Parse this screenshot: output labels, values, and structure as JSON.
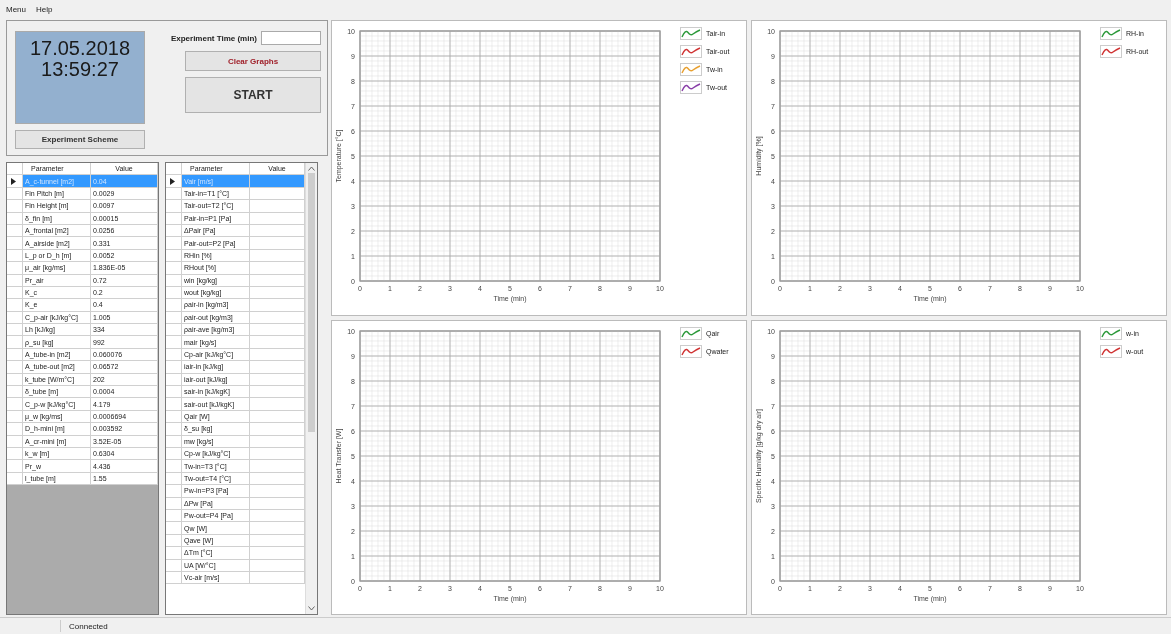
{
  "menu": [
    "Menu",
    "Help"
  ],
  "clock": {
    "date": "17.05.2018",
    "time": "13:59:27"
  },
  "experiment_time": {
    "label": "Experiment Time (min)"
  },
  "buttons": {
    "scheme": "Experiment Scheme",
    "clear": "Clear Graphs",
    "start": "START"
  },
  "tables": [
    {
      "has_scrollbar": false,
      "columns": [
        "Parameter",
        "Value"
      ],
      "rows": [
        {
          "parameter": "A_c-tunnel [m2]",
          "value": "0.04",
          "selected": true
        },
        {
          "parameter": "Fin Pitch [m]",
          "value": "0.0029",
          "selected": false
        },
        {
          "parameter": "Fin Height [m]",
          "value": "0.0097",
          "selected": false
        },
        {
          "parameter": "δ_fin [m]",
          "value": "0.00015",
          "selected": false
        },
        {
          "parameter": "A_frontal [m2]",
          "value": "0.0256",
          "selected": false
        },
        {
          "parameter": "A_airside [m2]",
          "value": "0.331",
          "selected": false
        },
        {
          "parameter": "L_p or D_h [m]",
          "value": "0.0052",
          "selected": false
        },
        {
          "parameter": "μ_air [kg/ms]",
          "value": "1.836E-05",
          "selected": false
        },
        {
          "parameter": "Pr_air",
          "value": "0.72",
          "selected": false
        },
        {
          "parameter": "K_c",
          "value": "0.2",
          "selected": false
        },
        {
          "parameter": "K_e",
          "value": "0.4",
          "selected": false
        },
        {
          "parameter": "C_p-air [kJ/kg°C]",
          "value": "1.005",
          "selected": false
        },
        {
          "parameter": "Lh [kJ/kg]",
          "value": "334",
          "selected": false
        },
        {
          "parameter": "ρ_su [kg]",
          "value": "992",
          "selected": false
        },
        {
          "parameter": "A_tube-in [m2]",
          "value": "0.060076",
          "selected": false
        },
        {
          "parameter": "A_tube-out [m2]",
          "value": "0.06572",
          "selected": false
        },
        {
          "parameter": "k_tube [W/m°C]",
          "value": "202",
          "selected": false
        },
        {
          "parameter": "δ_tube [m]",
          "value": "0.0004",
          "selected": false
        },
        {
          "parameter": "C_p-w [kJ/kg°C]",
          "value": "4.179",
          "selected": false
        },
        {
          "parameter": "μ_w [kg/ms]",
          "value": "0.0006694",
          "selected": false
        },
        {
          "parameter": "D_h-mini [m]",
          "value": "0.003592",
          "selected": false
        },
        {
          "parameter": "A_cr-mini [m]",
          "value": "3.52E-05",
          "selected": false
        },
        {
          "parameter": "k_w [m]",
          "value": "0.6304",
          "selected": false
        },
        {
          "parameter": "Pr_w",
          "value": "4.436",
          "selected": false
        },
        {
          "parameter": "l_tube [m]",
          "value": "1.55",
          "selected": false
        }
      ]
    },
    {
      "has_scrollbar": true,
      "columns": [
        "Parameter",
        "Value"
      ],
      "rows": [
        {
          "parameter": "Vair [m/s]",
          "selected": true
        },
        {
          "parameter": "Tair-in=T1 [°C]",
          "selected": false
        },
        {
          "parameter": "Tair-out=T2 [°C]",
          "selected": false
        },
        {
          "parameter": "Pair-in=P1 [Pa]",
          "selected": false
        },
        {
          "parameter": "ΔPair [Pa]",
          "selected": false
        },
        {
          "parameter": "Pair-out=P2 [Pa]",
          "selected": false
        },
        {
          "parameter": "RHin [%]",
          "selected": false
        },
        {
          "parameter": "RHout [%]",
          "selected": false
        },
        {
          "parameter": "win [kg/kg]",
          "selected": false
        },
        {
          "parameter": "wout [kg/kg]",
          "selected": false
        },
        {
          "parameter": "ρair-in [kg/m3]",
          "selected": false
        },
        {
          "parameter": "ρair-out [kg/m3]",
          "selected": false
        },
        {
          "parameter": "ρair-ave [kg/m3]",
          "selected": false
        },
        {
          "parameter": "mair [kg/s]",
          "selected": false
        },
        {
          "parameter": "Cp-air [kJ/kg°C]",
          "selected": false
        },
        {
          "parameter": "iair-in [kJ/kg]",
          "selected": false
        },
        {
          "parameter": "iair-out [kJ/kg]",
          "selected": false
        },
        {
          "parameter": "sair-in [kJ/kgK]",
          "selected": false
        },
        {
          "parameter": "sair-out [kJ/kgK]",
          "selected": false
        },
        {
          "parameter": "Qair [W]",
          "selected": false
        },
        {
          "parameter": "δ_su [kg]",
          "selected": false
        },
        {
          "parameter": "mw [kg/s]",
          "selected": false
        },
        {
          "parameter": "Cp-w [kJ/kg°C]",
          "selected": false
        },
        {
          "parameter": "Tw-in=T3 [°C]",
          "selected": false
        },
        {
          "parameter": "Tw-out=T4 [°C]",
          "selected": false
        },
        {
          "parameter": "Pw-in=P3 [Pa]",
          "selected": false
        },
        {
          "parameter": "ΔPw [Pa]",
          "selected": false
        },
        {
          "parameter": "Pw-out=P4 [Pa]",
          "selected": false
        },
        {
          "parameter": "Qw [W]",
          "selected": false
        },
        {
          "parameter": "Qave [W]",
          "selected": false
        },
        {
          "parameter": "ΔTm [°C]",
          "selected": false
        },
        {
          "parameter": "UA [W/°C]",
          "selected": false
        },
        {
          "parameter": "Vc-air [m/s]",
          "selected": false
        }
      ]
    }
  ],
  "charts": [
    {
      "chart_data": {
        "type": "line",
        "grid": true,
        "xlabel": "Time (min)",
        "ylabel": "Temperature [°C]",
        "categories": [
          "0",
          "1",
          "2",
          "3",
          "4",
          "5",
          "6",
          "7",
          "8",
          "9",
          "10"
        ],
        "ylim": [
          0,
          10
        ],
        "yticks": [
          0,
          1,
          2,
          3,
          4,
          5,
          6,
          7,
          8,
          9,
          10
        ],
        "series": [
          {
            "name": "Tair-in",
            "color": "#2e9a3c",
            "values": [
              null,
              null,
              null,
              null,
              null,
              null,
              null,
              null,
              null,
              null,
              null
            ]
          },
          {
            "name": "Tair-out",
            "color": "#d03434",
            "values": [
              null,
              null,
              null,
              null,
              null,
              null,
              null,
              null,
              null,
              null,
              null
            ]
          },
          {
            "name": "Tw-in",
            "color": "#e8a030",
            "values": [
              null,
              null,
              null,
              null,
              null,
              null,
              null,
              null,
              null,
              null,
              null
            ]
          },
          {
            "name": "Tw-out",
            "color": "#8a3fa8",
            "values": [
              null,
              null,
              null,
              null,
              null,
              null,
              null,
              null,
              null,
              null,
              null
            ]
          }
        ]
      }
    },
    {
      "chart_data": {
        "type": "line",
        "grid": true,
        "xlabel": "Time (min)",
        "ylabel": "Humidity [%]",
        "categories": [
          "0",
          "1",
          "2",
          "3",
          "4",
          "5",
          "6",
          "7",
          "8",
          "9",
          "10"
        ],
        "ylim": [
          0,
          10
        ],
        "yticks": [
          0,
          1,
          2,
          3,
          4,
          5,
          6,
          7,
          8,
          9,
          10
        ],
        "series": [
          {
            "name": "RH-in",
            "color": "#2e9a3c",
            "values": [
              null,
              null,
              null,
              null,
              null,
              null,
              null,
              null,
              null,
              null,
              null
            ]
          },
          {
            "name": "RH-out",
            "color": "#d03434",
            "values": [
              null,
              null,
              null,
              null,
              null,
              null,
              null,
              null,
              null,
              null,
              null
            ]
          }
        ]
      }
    },
    {
      "chart_data": {
        "type": "line",
        "grid": true,
        "xlabel": "Time (min)",
        "ylabel": "Heat Transfer [W]",
        "categories": [
          "0",
          "1",
          "2",
          "3",
          "4",
          "5",
          "6",
          "7",
          "8",
          "9",
          "10"
        ],
        "ylim": [
          0,
          10
        ],
        "yticks": [
          0,
          1,
          2,
          3,
          4,
          5,
          6,
          7,
          8,
          9,
          10
        ],
        "series": [
          {
            "name": "Qair",
            "color": "#2e9a3c",
            "values": [
              null,
              null,
              null,
              null,
              null,
              null,
              null,
              null,
              null,
              null,
              null
            ]
          },
          {
            "name": "Qwater",
            "color": "#d03434",
            "values": [
              null,
              null,
              null,
              null,
              null,
              null,
              null,
              null,
              null,
              null,
              null
            ]
          }
        ]
      }
    },
    {
      "chart_data": {
        "type": "line",
        "grid": true,
        "xlabel": "Time (min)",
        "ylabel": "Specific Humidity [g/kg dry air]",
        "categories": [
          "0",
          "1",
          "2",
          "3",
          "4",
          "5",
          "6",
          "7",
          "8",
          "9",
          "10"
        ],
        "ylim": [
          0,
          10
        ],
        "yticks": [
          0,
          1,
          2,
          3,
          4,
          5,
          6,
          7,
          8,
          9,
          10
        ],
        "series": [
          {
            "name": "w-in",
            "color": "#2e9a3c",
            "values": [
              null,
              null,
              null,
              null,
              null,
              null,
              null,
              null,
              null,
              null,
              null
            ]
          },
          {
            "name": "w-out",
            "color": "#d03434",
            "values": [
              null,
              null,
              null,
              null,
              null,
              null,
              null,
              null,
              null,
              null,
              null
            ]
          }
        ]
      }
    }
  ],
  "status_bar": {
    "text": "Connected"
  }
}
